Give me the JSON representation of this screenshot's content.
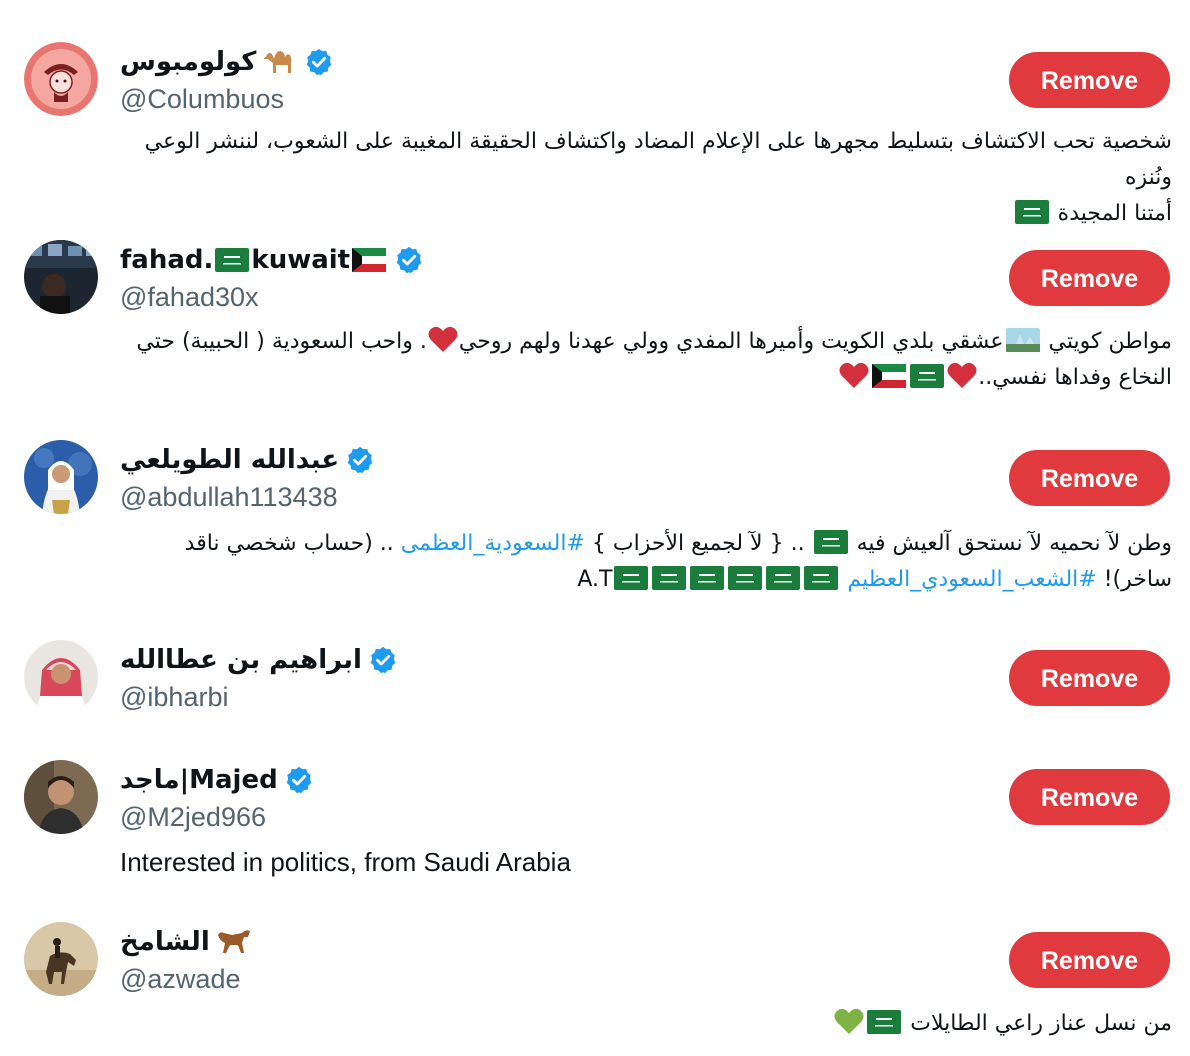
{
  "colors": {
    "remove_button": "#e0393e",
    "hashtag": "#1d9bf0",
    "handle": "#536471",
    "verified": "#1d9bf0",
    "heart": "#d32f3c",
    "green_heart": "#7cb342"
  },
  "users": [
    {
      "name": "كولومبوس",
      "emoji": "camel-emoji-icon",
      "handle": "@Columbuos",
      "remove_label": "Remove",
      "bio_line1": "شخصية تحب الاكتشاف بتسليط مجهرها على الإعلام المضاد واكتشاف الحقيقة المغيبة على الشعوب، لننشر الوعي ونُنزه",
      "bio_line2": "أمتنا المجيدة"
    },
    {
      "name_part1": "fahad.",
      "name_part2": "kuwait",
      "handle": "@fahad30x",
      "remove_label": "Remove",
      "bio_line1_a": "مواطن كويتي",
      "bio_line1_b": "عشقي بلدي الكويت وأميرها المفدي وولي عهدنا ولهم روحي",
      "bio_line1_c": ". واحب السعودية ( الحبيبة) حتي",
      "bio_line2": "النخاع وفداها نفسي.."
    },
    {
      "name": "عبدالله الطويلعي",
      "handle": "@abdullah113438",
      "remove_label": "Remove",
      "bio_line1_a": "وطن لآ نحميه لآ نستحق آلعيش فيه",
      "bio_line1_b": ".. { لآ لجميع الأحزاب }",
      "bio_line1_hashtag": "#السعودية_العظمى",
      "bio_line1_c": ".. (حساب شخصي ناقد",
      "bio_line2_a": "ساخر)!",
      "bio_line2_hashtag": "#الشعب_السعودي_العظيم",
      "bio_line2_b": "A.T"
    },
    {
      "name": "ابراهيم بن عطاالله",
      "handle": "@ibharbi",
      "remove_label": "Remove"
    },
    {
      "name_part1": "ماجد|",
      "name_part2": "Majed",
      "handle": "@M2jed966",
      "remove_label": "Remove",
      "bio": "Interested in politics, from Saudi Arabia"
    },
    {
      "name": "الشامخ",
      "emoji": "horse-emoji-icon",
      "handle": "@azwade",
      "remove_label": "Remove",
      "bio": "من نسل عناز راعي الطايلات"
    }
  ]
}
